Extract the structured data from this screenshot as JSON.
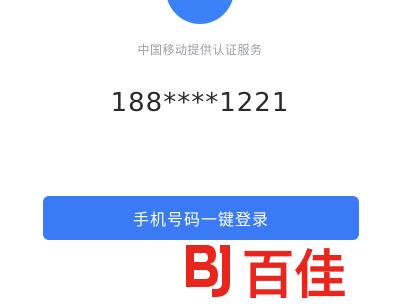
{
  "logo": {
    "icon": "china-mobile-logo-icon",
    "color": "#3b82f6"
  },
  "service_provider": "中国移动提供认证服务",
  "phone_number": "188****1221",
  "login_button": {
    "label": "手机号码一键登录",
    "color": "#3a7bf5"
  },
  "watermark": {
    "text": "百佳",
    "icon": "bj-logo-icon",
    "color": "#e8261e"
  }
}
